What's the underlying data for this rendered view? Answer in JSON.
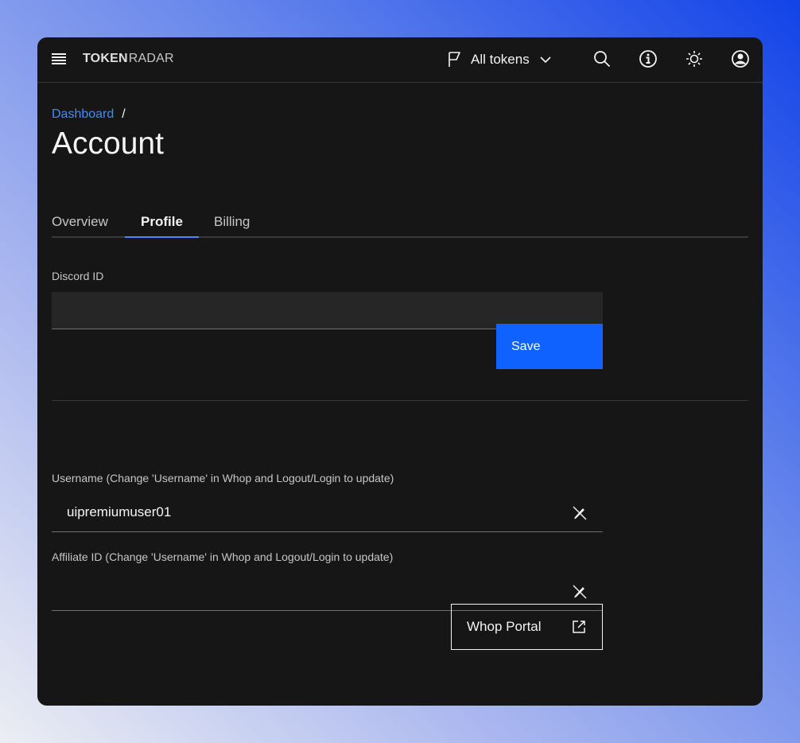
{
  "header": {
    "brand_bold": "TOKEN",
    "brand_light": "RADAR",
    "token_selector": {
      "label": "All tokens",
      "icon": "flag-icon"
    },
    "icons": [
      "menu-icon",
      "search-icon",
      "info-icon",
      "sun-icon",
      "user-avatar-icon"
    ]
  },
  "breadcrumb": {
    "link": "Dashboard",
    "separator": "/"
  },
  "page": {
    "title": "Account"
  },
  "tabs": [
    {
      "label": "Overview",
      "active": false
    },
    {
      "label": "Profile",
      "active": true
    },
    {
      "label": "Billing",
      "active": false
    }
  ],
  "form": {
    "discord": {
      "label": "Discord ID",
      "value": "",
      "placeholder": ""
    },
    "save_label": "Save",
    "username": {
      "label": "Username (Change 'Username' in Whop and Logout/Login to update)",
      "value": "uipremiumuser01"
    },
    "affiliate": {
      "label": "Affiliate ID (Change 'Username' in Whop and Logout/Login to update)",
      "value": ""
    },
    "whop_label": "Whop Portal"
  },
  "colors": {
    "accent": "#0f62fe",
    "link": "#4589ff",
    "background": "#161616",
    "field": "#262626"
  }
}
